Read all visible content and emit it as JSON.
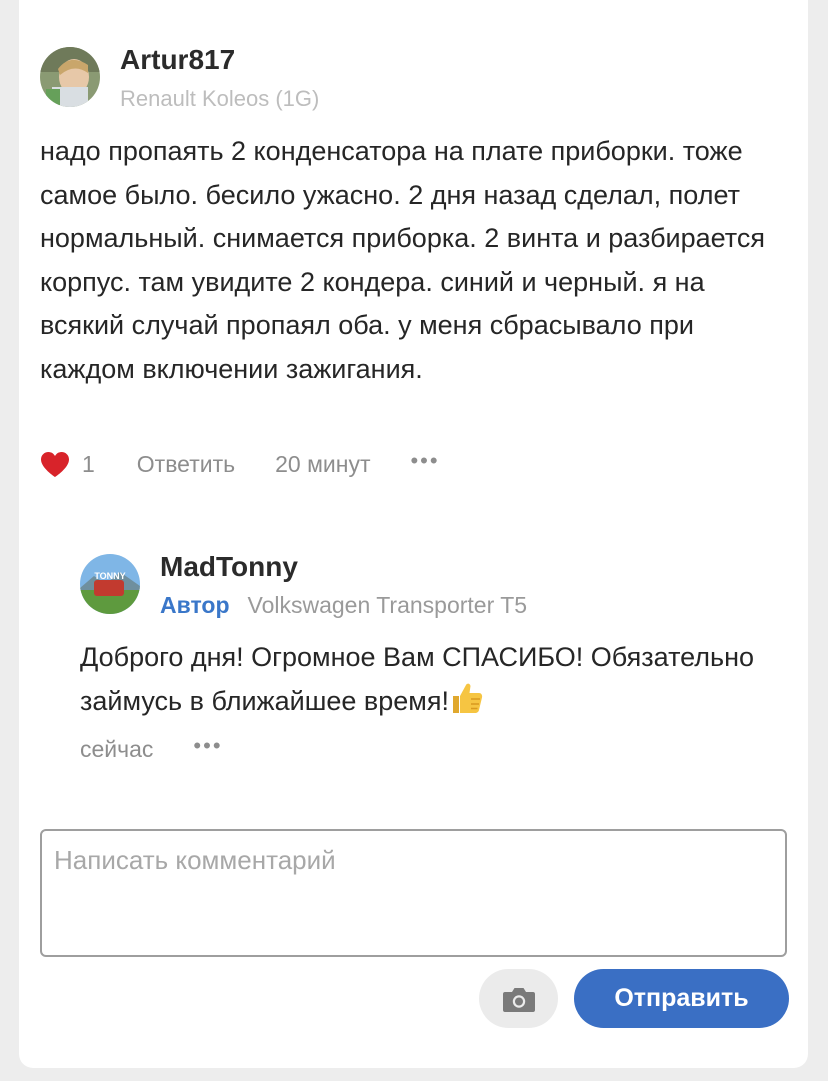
{
  "comments": [
    {
      "username": "Artur817",
      "car": "Renault Koleos (1G)",
      "text": "надо пропаять 2 конденсатора на плате приборки. тоже самое было. бесило ужасно. 2 дня назад сделал, полет нормальный. снимается приборка. 2 винта и разбирается корпус. там увидите 2 кондера. синий и черный. я на всякий случай пропаял оба. у меня сбрасывало при каждом включении зажигания.",
      "like_count": "1",
      "reply_label": "Ответить",
      "time": "20 минут",
      "more": "•••",
      "like_color": "#d8232a"
    },
    {
      "username": "MadTonny",
      "author_badge": "Автор",
      "car": "Volkswagen Transporter T5",
      "text": "Доброго дня! Огромное Вам СПАСИБО! Обязательно займусь в ближайшее время!",
      "emoji": "thumbs-up",
      "time": "сейчас",
      "more": "•••"
    }
  ],
  "composer": {
    "placeholder": "Написать комментарий",
    "send_label": "Отправить",
    "camera_icon": "camera-icon",
    "accent": "#3a6fc4"
  }
}
